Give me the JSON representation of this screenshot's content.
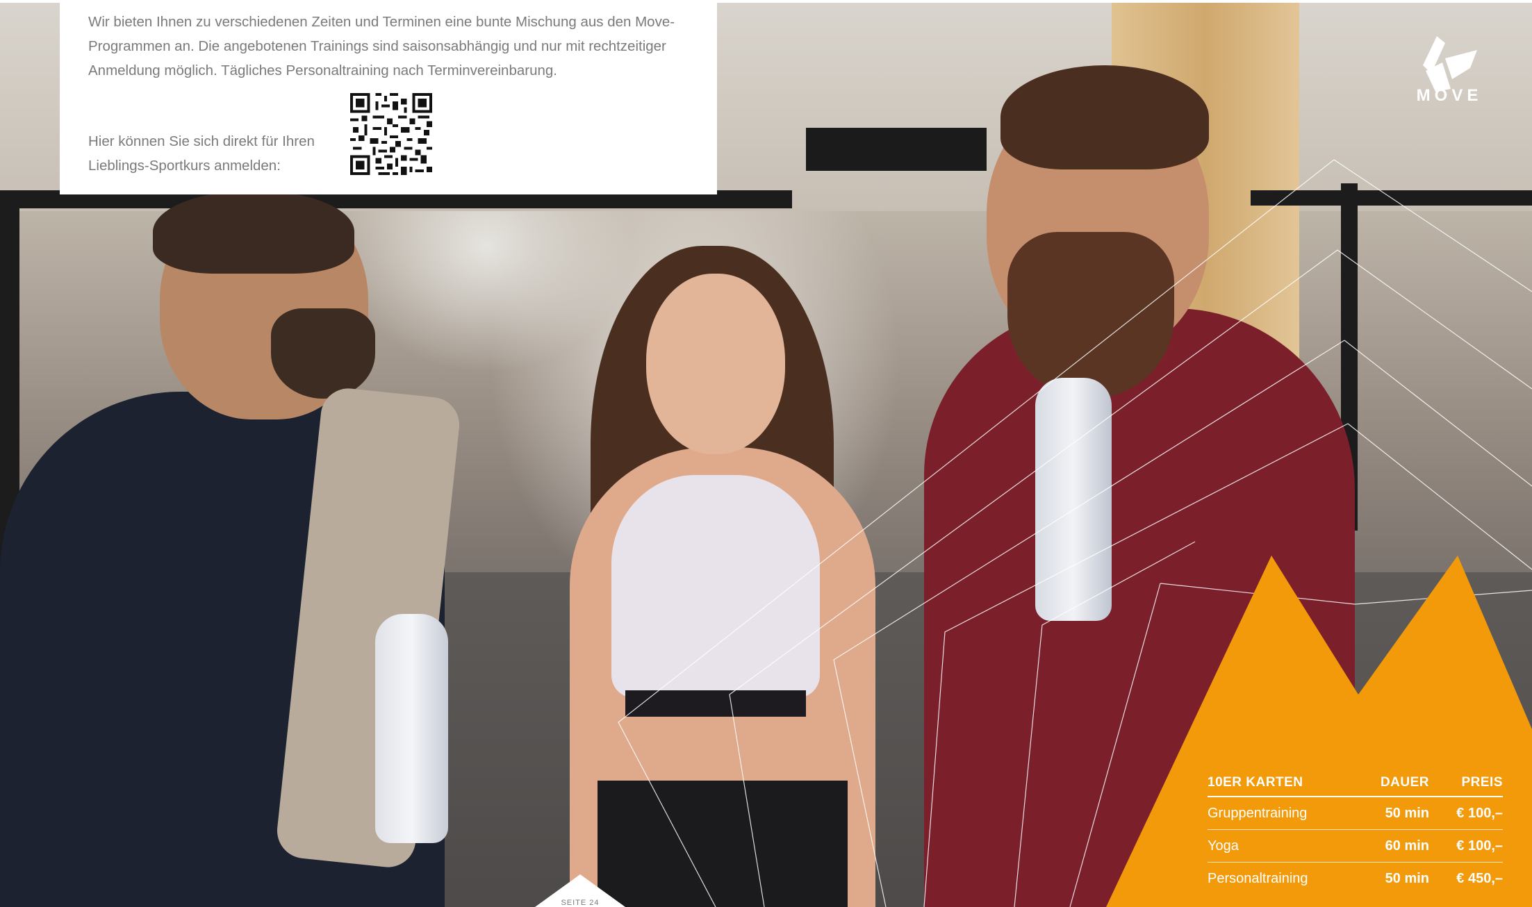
{
  "intro_text": "Wir bieten Ihnen zu verschiedenen Zeiten und Terminen eine bunte Mischung aus den Move-Programmen an. Die angebotenen Trainings sind saisonsabhängig und nur mit rechtzeitiger Anmeldung möglich. Tägliches Personaltraining nach Terminvereinbarung.",
  "signup_text": "Hier können Sie sich direkt für Ihren Lieblings-Sportkurs anmelden:",
  "logo": {
    "text": "MOVE",
    "icon": "move-logo-icon"
  },
  "colors": {
    "accent": "#F39A0A",
    "text_grey": "#7A7A7A"
  },
  "price_table": {
    "headers": [
      "10ER KARTEN",
      "DAUER",
      "PREIS"
    ],
    "rows": [
      {
        "name": "Gruppentraining",
        "duration": "50 min",
        "price": "€ 100,–"
      },
      {
        "name": "Yoga",
        "duration": "60 min",
        "price": "€ 100,–"
      },
      {
        "name": "Personaltraining",
        "duration": "50 min",
        "price": "€ 450,–"
      }
    ]
  },
  "page_label": "SEITE 24"
}
